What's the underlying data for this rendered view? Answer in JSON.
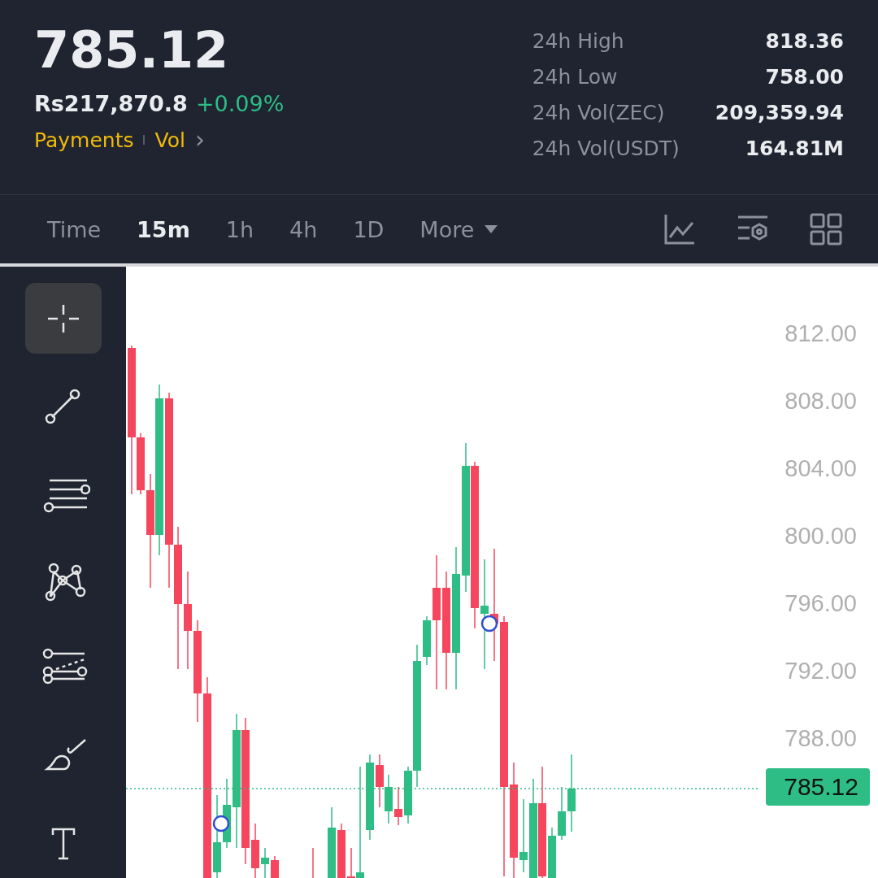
{
  "ticker": {
    "price": "785.12",
    "fiat_price": "Rs217,870.8",
    "change": "+0.09%",
    "links": [
      "Payments",
      "Vol"
    ],
    "chevron": "›"
  },
  "stats": [
    {
      "label": "24h High",
      "value": "818.36"
    },
    {
      "label": "24h Low",
      "value": "758.00"
    },
    {
      "label": "24h Vol(ZEC)",
      "value": "209,359.94"
    },
    {
      "label": "24h Vol(USDT)",
      "value": "164.81M"
    }
  ],
  "intervals": [
    {
      "label": "Time",
      "selected": false
    },
    {
      "label": "15m",
      "selected": true
    },
    {
      "label": "1h",
      "selected": false
    },
    {
      "label": "4h",
      "selected": false
    },
    {
      "label": "1D",
      "selected": false
    },
    {
      "label": "More",
      "selected": false,
      "dropdown": true
    }
  ],
  "tools": [
    {
      "kind": "crosshair",
      "selected": true
    },
    {
      "kind": "line",
      "selected": false
    },
    {
      "kind": "parallel",
      "selected": false
    },
    {
      "kind": "pattern",
      "selected": false
    },
    {
      "kind": "fib",
      "selected": false
    },
    {
      "kind": "brush",
      "selected": false
    },
    {
      "kind": "text",
      "selected": false
    }
  ],
  "chart": {
    "y_labels": [
      "812.00",
      "808.00",
      "804.00",
      "800.00",
      "796.00",
      "792.00",
      "788.00"
    ],
    "current_price": "785.12"
  }
}
